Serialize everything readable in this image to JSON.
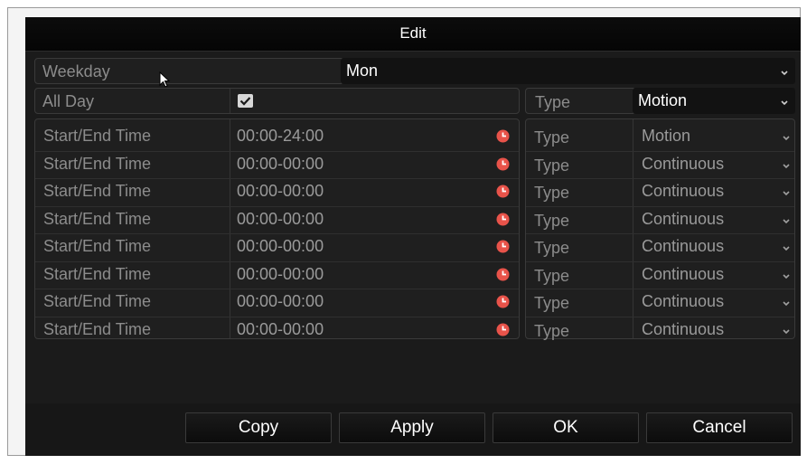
{
  "dialog": {
    "title": "Edit",
    "weekday_label": "Weekday",
    "weekday_value": "Mon",
    "allday_label": "All Day",
    "allday_checked": true,
    "type_label": "Type",
    "type_value": "Motion"
  },
  "schedule_rows": [
    {
      "label": "Start/End Time",
      "time": "00:00-24:00",
      "type_label": "Type",
      "type": "Motion"
    },
    {
      "label": "Start/End Time",
      "time": "00:00-00:00",
      "type_label": "Type",
      "type": "Continuous"
    },
    {
      "label": "Start/End Time",
      "time": "00:00-00:00",
      "type_label": "Type",
      "type": "Continuous"
    },
    {
      "label": "Start/End Time",
      "time": "00:00-00:00",
      "type_label": "Type",
      "type": "Continuous"
    },
    {
      "label": "Start/End Time",
      "time": "00:00-00:00",
      "type_label": "Type",
      "type": "Continuous"
    },
    {
      "label": "Start/End Time",
      "time": "00:00-00:00",
      "type_label": "Type",
      "type": "Continuous"
    },
    {
      "label": "Start/End Time",
      "time": "00:00-00:00",
      "type_label": "Type",
      "type": "Continuous"
    },
    {
      "label": "Start/End Time",
      "time": "00:00-00:00",
      "type_label": "Type",
      "type": "Continuous"
    }
  ],
  "buttons": {
    "copy": "Copy",
    "apply": "Apply",
    "ok": "OK",
    "cancel": "Cancel"
  },
  "icons": {
    "clock": "clock-icon",
    "dropdown": "chevron-down-icon",
    "checkbox": "checkmark-icon",
    "cursor": "mouse-pointer-icon"
  },
  "colors": {
    "clock_accent": "#e8534a",
    "dialog_bg": "#1b1b1b"
  }
}
